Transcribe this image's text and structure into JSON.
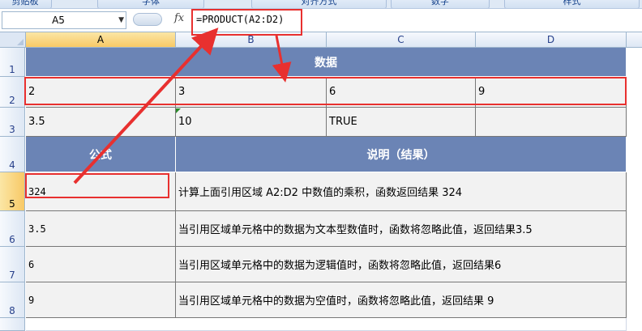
{
  "ribbon": {
    "groups": [
      "剪贴板",
      "字体",
      "对齐方式",
      "数字",
      "样式"
    ]
  },
  "formula_bar": {
    "name_box": "A5",
    "fx": "fx",
    "formula": "=PRODUCT(A2:D2)"
  },
  "columns": [
    "A",
    "B",
    "C",
    "D"
  ],
  "rows": [
    "1",
    "2",
    "3",
    "4",
    "5",
    "6",
    "7",
    "8"
  ],
  "selected": {
    "column": "A",
    "row": "5"
  },
  "table": {
    "title": "数据",
    "data_row_1": [
      "2",
      "3",
      "6",
      "9"
    ],
    "data_row_2": [
      "3.5",
      "10",
      "TRUE",
      ""
    ],
    "headers": {
      "formula": "公式",
      "description": "说明（结果）"
    },
    "examples": [
      {
        "formula": "324",
        "description": "计算上面引用区域 A2:D2 中数值的乘积，函数返回结果 324"
      },
      {
        "formula": "3.5",
        "description": "当引用区域单元格中的数据为文本型数值时，函数将忽略此值，返回结果3.5"
      },
      {
        "formula": "6",
        "description": "当引用区域单元格中的数据为逻辑值时，函数将忽略此值，返回结果6"
      },
      {
        "formula": "9",
        "description": "当引用区域单元格中的数据为空值时，函数将忽略此值，返回结果 9"
      }
    ]
  },
  "colors": {
    "header_fill": "#6b84b5",
    "highlight": "#e8302f"
  }
}
